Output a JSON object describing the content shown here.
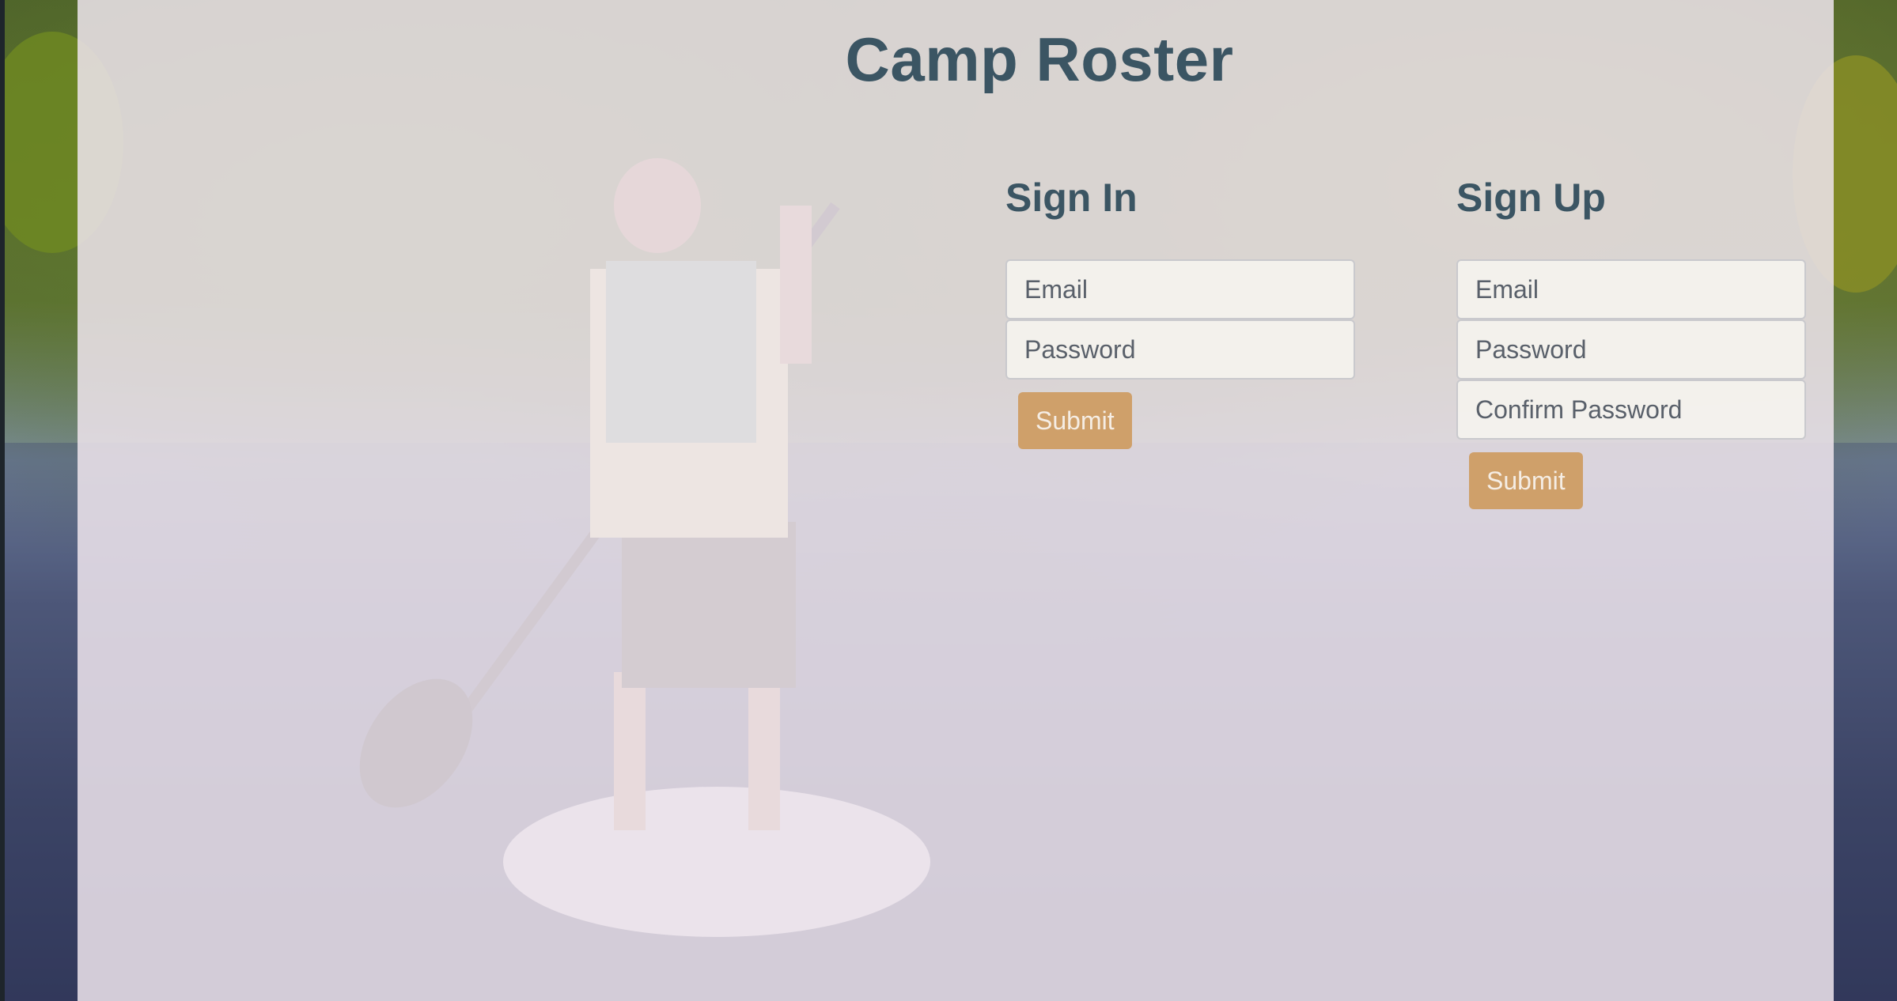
{
  "app": {
    "title": "Camp Roster"
  },
  "signin": {
    "heading": "Sign In",
    "email_placeholder": "Email",
    "password_placeholder": "Password",
    "submit_label": "Submit"
  },
  "signup": {
    "heading": "Sign Up",
    "email_placeholder": "Email",
    "password_placeholder": "Password",
    "confirm_placeholder": "Confirm Password",
    "submit_label": "Submit"
  },
  "colors": {
    "heading": "#3b5563",
    "accent": "#cfa06a",
    "overlay": "#eee4ec"
  }
}
